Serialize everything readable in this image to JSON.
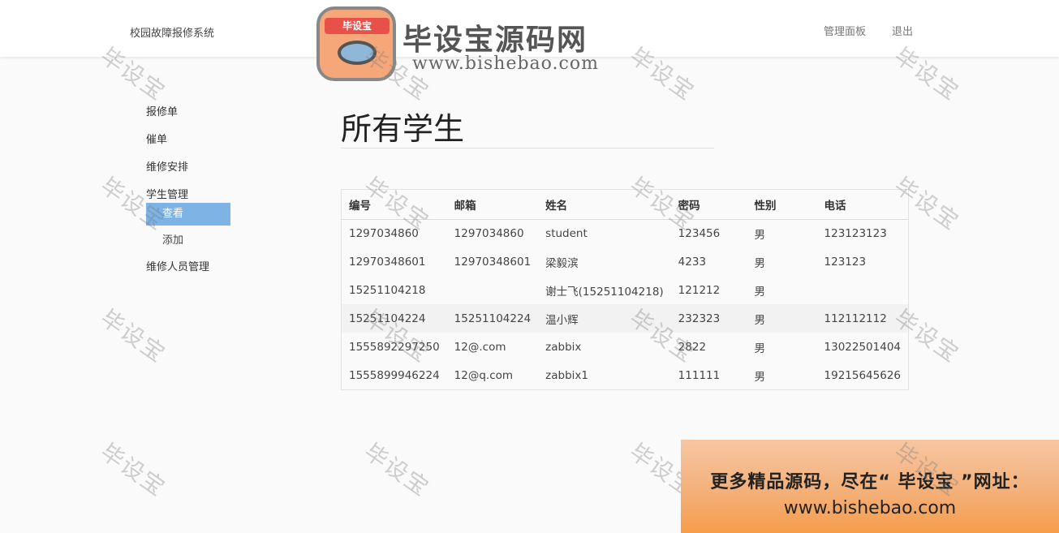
{
  "header": {
    "brand": "校园故障报修系统",
    "nav": [
      "管理面板",
      "退出"
    ]
  },
  "watermark": {
    "badge_text": "毕设宝",
    "title": "毕设宝源码网",
    "url": "www.bishebao.com",
    "stamp": "毕设宝"
  },
  "sidebar": {
    "items": [
      "报修单",
      "催单",
      "维修安排",
      "学生管理",
      "维修人员管理"
    ],
    "student_sub": [
      "查看",
      "添加"
    ],
    "active_sub": "查看"
  },
  "main": {
    "title": "所有学生",
    "table": {
      "headers": [
        "编号",
        "邮箱",
        "姓名",
        "密码",
        "性别",
        "电话"
      ],
      "rows": [
        [
          "1297034860",
          "1297034860",
          "student",
          "123456",
          "男",
          "123123123"
        ],
        [
          "12970348601",
          "12970348601",
          "梁毅滨",
          "4233",
          "男",
          "123123"
        ],
        [
          "15251104218",
          "",
          "谢士飞(15251104218)",
          "121212",
          "男",
          ""
        ],
        [
          "15251104224",
          "15251104224",
          "温小辉",
          "232323",
          "男",
          "112112112"
        ],
        [
          "1555892297250",
          "12@.com",
          "zabbix",
          "2822",
          "男",
          "13022501404"
        ],
        [
          "1555899946224",
          "12@q.com",
          "zabbix1",
          "111111",
          "男",
          "19215645626"
        ]
      ]
    }
  },
  "promo": {
    "line1": "更多精品源码，尽在“ 毕设宝 ”网址：",
    "line2": "www.bishebao.com"
  }
}
